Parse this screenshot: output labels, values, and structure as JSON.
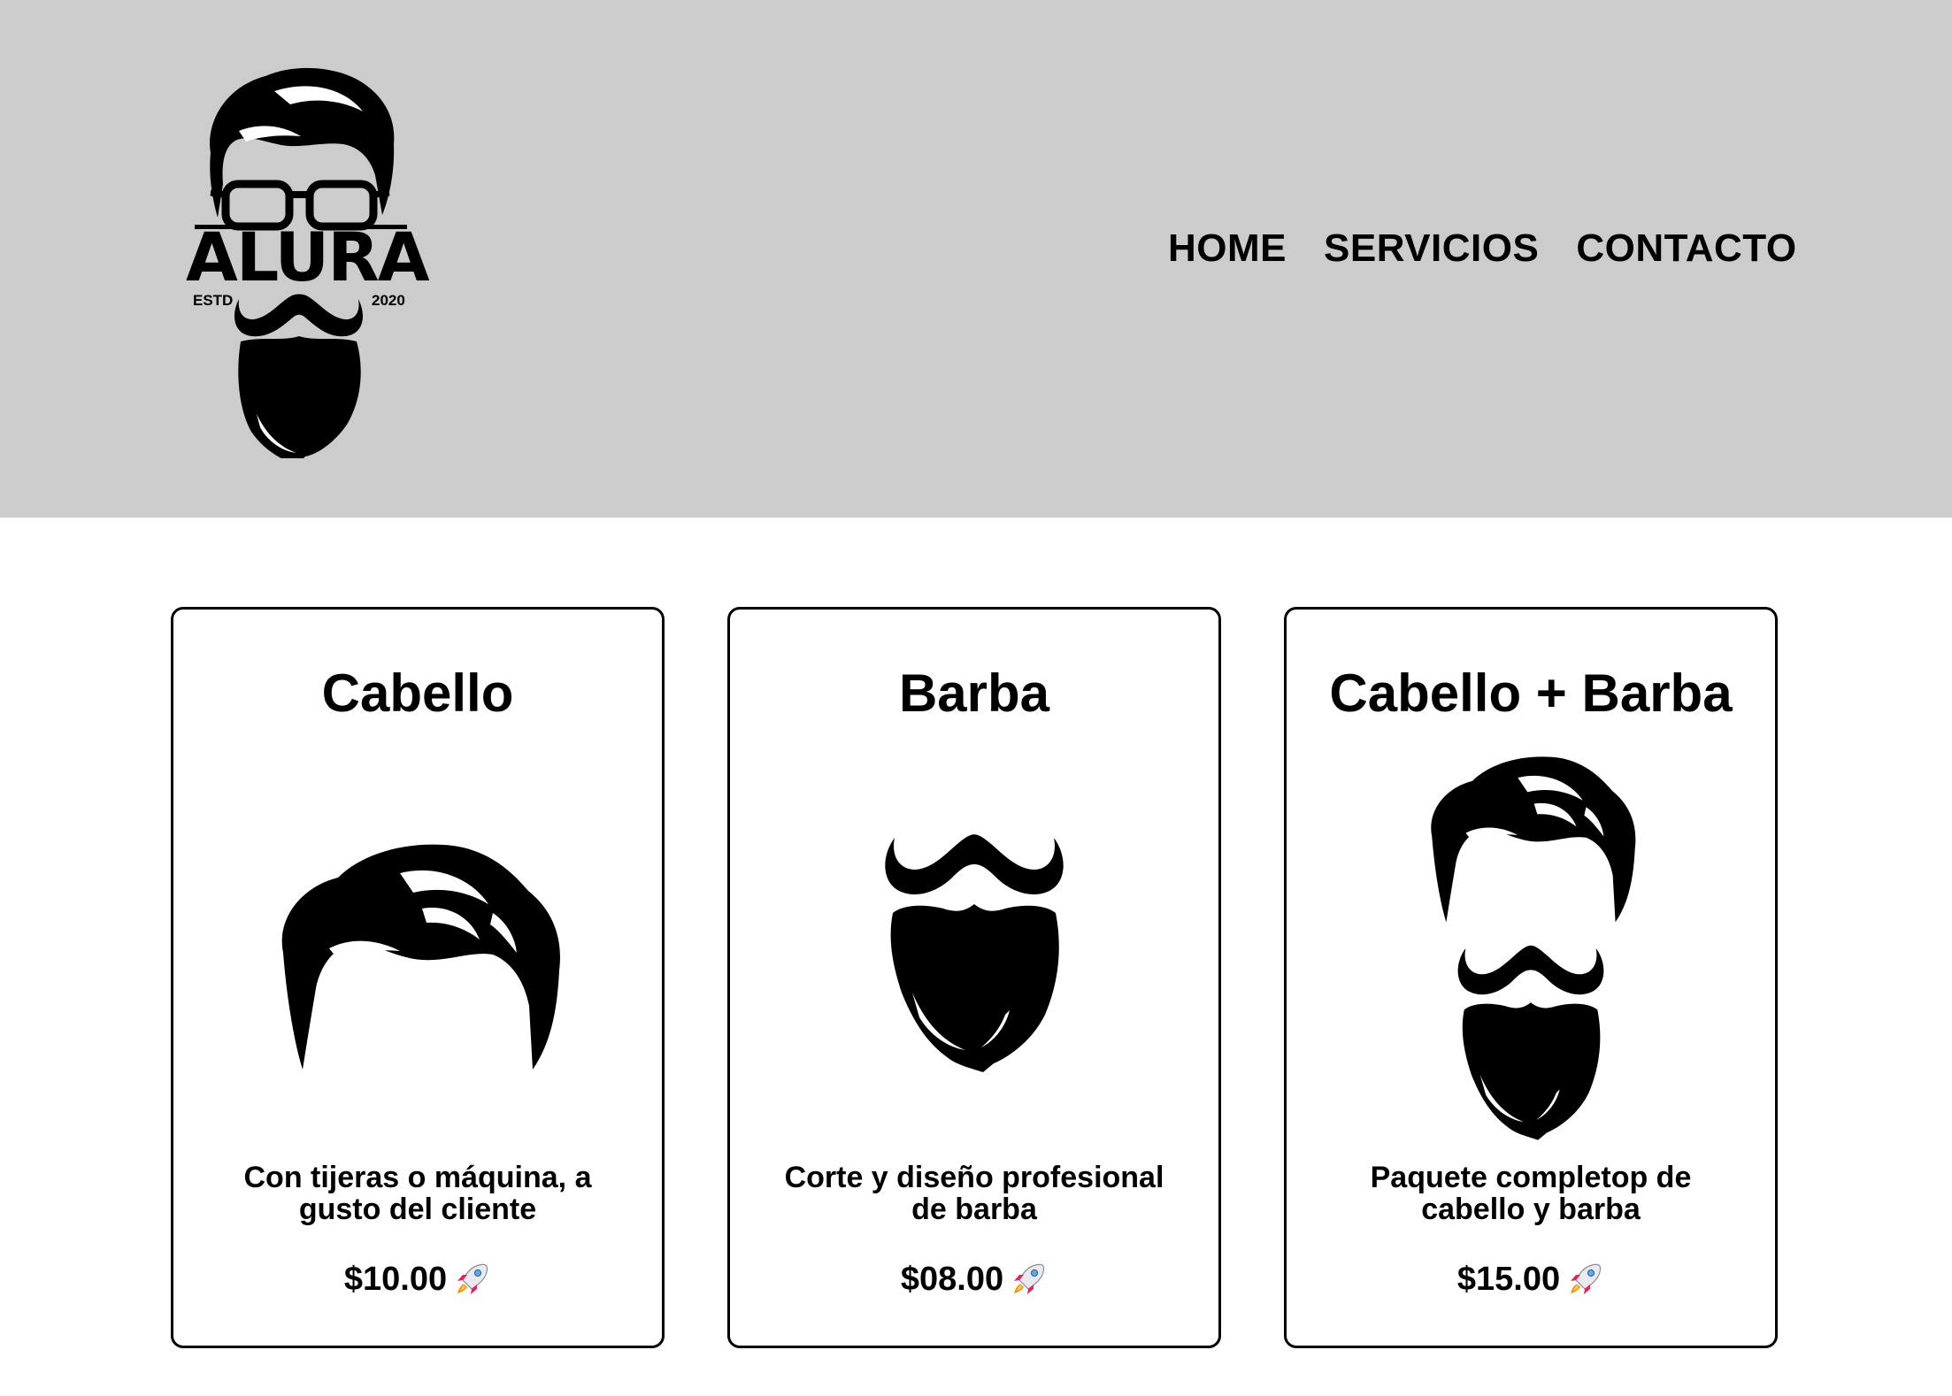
{
  "brand": {
    "logo_text": "ALURA",
    "logo_left": "ESTD",
    "logo_right": "2020",
    "icon": "bearded-man-glasses-logo"
  },
  "nav": {
    "items": [
      {
        "label": "HOME"
      },
      {
        "label": "SERVICIOS"
      },
      {
        "label": "CONTACTO"
      }
    ]
  },
  "services": [
    {
      "title": "Cabello",
      "description": "Con tijeras o máquina, a gusto del cliente",
      "price": "$10.00",
      "icon": "hair-icon",
      "badge_icon": "rocket-icon"
    },
    {
      "title": "Barba",
      "description": "Corte y diseño profesional de barba",
      "price": "$08.00",
      "icon": "beard-icon",
      "badge_icon": "rocket-icon"
    },
    {
      "title": "Cabello + Barba",
      "description": "Paquete completop de cabello y barba",
      "price": "$15.00",
      "icon": "hair-and-beard-icon",
      "badge_icon": "rocket-icon"
    }
  ],
  "colors": {
    "header_bg": "#cccccc",
    "text": "#000000",
    "card_border": "#000000"
  }
}
